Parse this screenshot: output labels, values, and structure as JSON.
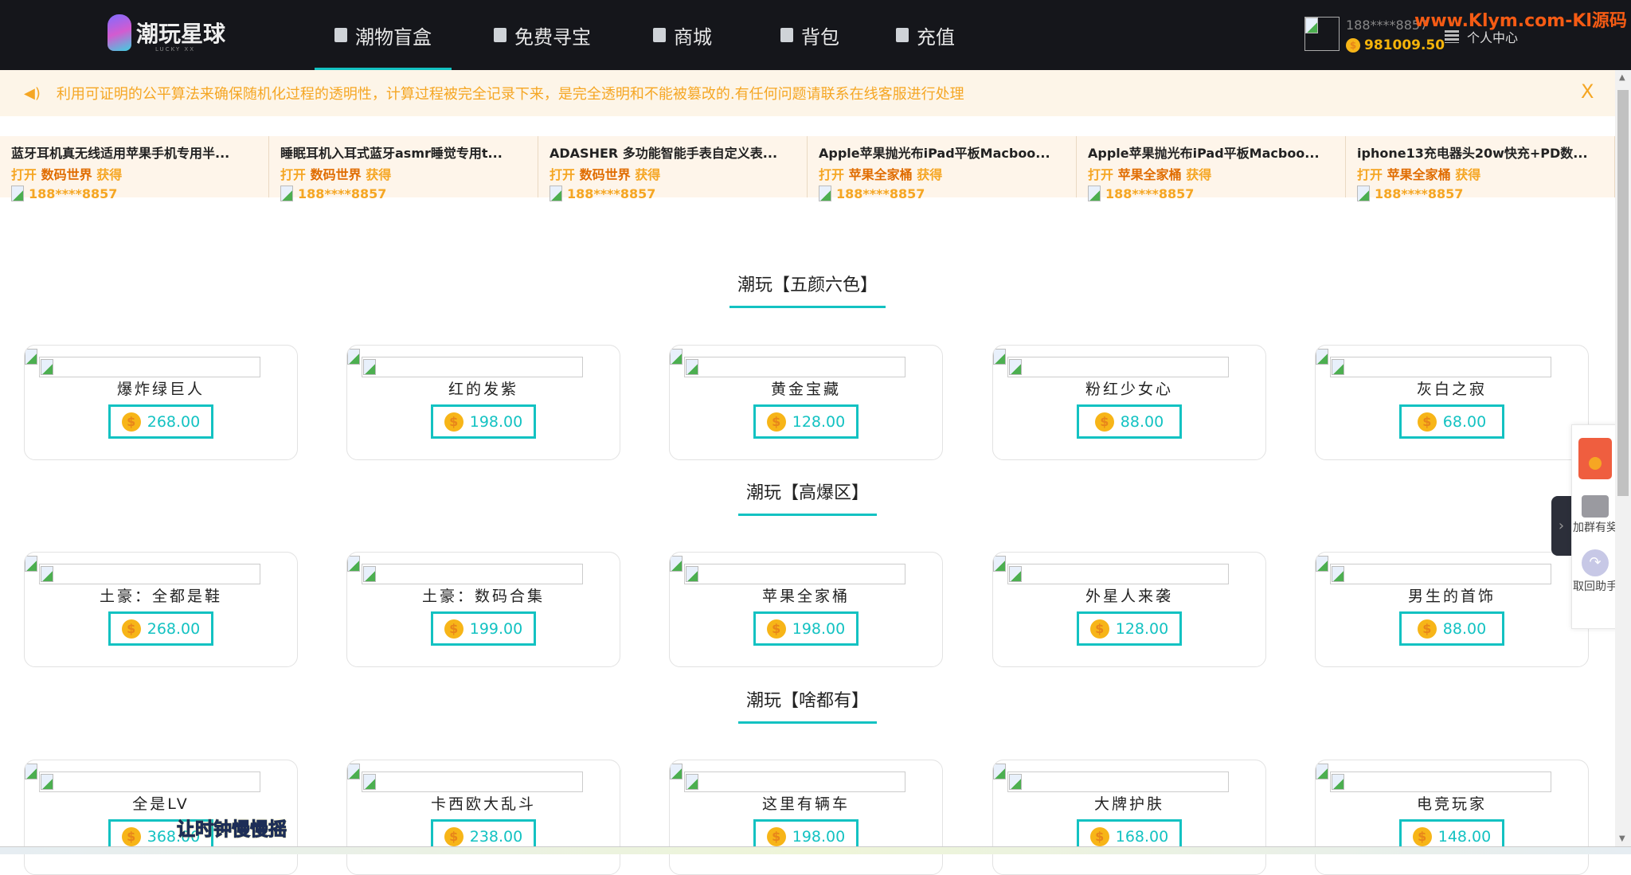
{
  "header": {
    "logo_text": "潮玩星球",
    "logo_sub": "LUCKY XX",
    "nav": [
      {
        "label": "潮物盲盒",
        "icon": "box-icon",
        "active": true
      },
      {
        "label": "免费寻宝",
        "icon": "broken-image-icon"
      },
      {
        "label": "商城",
        "icon": "broken-image-icon"
      },
      {
        "label": "背包",
        "icon": "bag-icon"
      },
      {
        "label": "充值",
        "icon": "wallet-icon"
      }
    ],
    "user": {
      "phone": "188****8857",
      "balance": "981009.50",
      "center_label": "个人中心"
    },
    "watermark": "www.Klym.com-Kl源码"
  },
  "notice": {
    "text": "利用可证明的公平算法来确保随机化过程的透明性，计算过程被完全记录下来，是完全透明和不能被篡改的.有任何问题请联系在线客服进行处理",
    "close": "X"
  },
  "ticker": [
    {
      "title": "蓝牙耳机真无线适用苹果手机专用半...",
      "open": "打开",
      "box": "数码世界",
      "got": "获得",
      "user": "188****8857"
    },
    {
      "title": "睡眠耳机入耳式蓝牙asmr睡觉专用t...",
      "open": "打开",
      "box": "数码世界",
      "got": "获得",
      "user": "188****8857"
    },
    {
      "title": "ADASHER 多功能智能手表自定义表...",
      "open": "打开",
      "box": "数码世界",
      "got": "获得",
      "user": "188****8857"
    },
    {
      "title": "Apple苹果抛光布iPad平板Macboo...",
      "open": "打开",
      "box": "苹果全家桶",
      "got": "获得",
      "user": "188****8857"
    },
    {
      "title": "Apple苹果抛光布iPad平板Macboo...",
      "open": "打开",
      "box": "苹果全家桶",
      "got": "获得",
      "user": "188****8857"
    },
    {
      "title": "iphone13充电器头20w快充+PD数...",
      "open": "打开",
      "box": "苹果全家桶",
      "got": "获得",
      "user": "188****8857"
    }
  ],
  "sections": [
    {
      "title": "潮玩【五颜六色】",
      "items": [
        {
          "name": "爆炸绿巨人",
          "price": "268.00"
        },
        {
          "name": "红的发紫",
          "price": "198.00"
        },
        {
          "name": "黄金宝藏",
          "price": "128.00"
        },
        {
          "name": "粉红少女心",
          "price": "88.00"
        },
        {
          "name": "灰白之寂",
          "price": "68.00"
        }
      ]
    },
    {
      "title": "潮玩【高爆区】",
      "items": [
        {
          "name": "土豪：全都是鞋",
          "price": "268.00"
        },
        {
          "name": "土豪：数码合集",
          "price": "199.00"
        },
        {
          "name": "苹果全家桶",
          "price": "198.00"
        },
        {
          "name": "外星人来袭",
          "price": "128.00"
        },
        {
          "name": "男生的首饰",
          "price": "88.00"
        }
      ]
    },
    {
      "title": "潮玩【啥都有】",
      "items": [
        {
          "name": "全是LV",
          "price": "368.00"
        },
        {
          "name": "卡西欧大乱斗",
          "price": "238.00"
        },
        {
          "name": "这里有辆车",
          "price": "198.00"
        },
        {
          "name": "大牌护肤",
          "price": "168.00"
        },
        {
          "name": "电竞玩家",
          "price": "148.00"
        }
      ]
    }
  ],
  "float": {
    "group_label": "加群有奖",
    "retrieve_label": "取回助手"
  },
  "overlay_text": "让时钟慢慢摇",
  "colors": {
    "accent": "#13c2c2",
    "header_bg": "#15161b",
    "notice": "#f5a623",
    "coin": "#f7b518"
  }
}
